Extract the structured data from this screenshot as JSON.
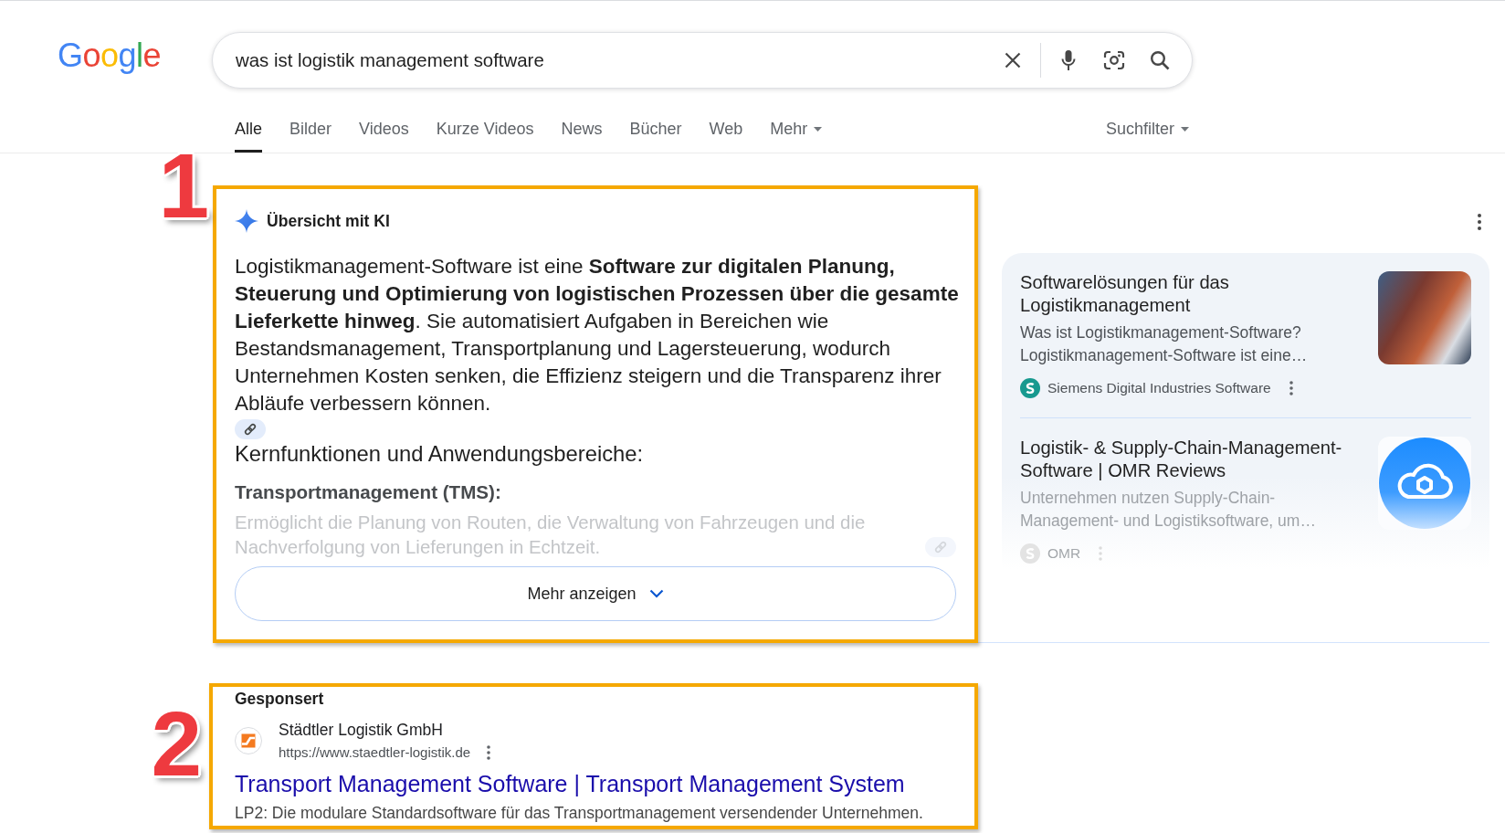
{
  "header": {
    "logo": "Google",
    "search": {
      "value": "was ist logistik management software"
    }
  },
  "tabs": [
    {
      "label": "Alle",
      "selected": true,
      "dropdown": false
    },
    {
      "label": "Bilder",
      "selected": false,
      "dropdown": false
    },
    {
      "label": "Videos",
      "selected": false,
      "dropdown": false
    },
    {
      "label": "Kurze Videos",
      "selected": false,
      "dropdown": false
    },
    {
      "label": "News",
      "selected": false,
      "dropdown": false
    },
    {
      "label": "Bücher",
      "selected": false,
      "dropdown": false
    },
    {
      "label": "Web",
      "selected": false,
      "dropdown": false
    },
    {
      "label": "Mehr",
      "selected": false,
      "dropdown": true
    }
  ],
  "search_filter": {
    "label": "Suchfilter",
    "dropdown": true
  },
  "ai_overview": {
    "annotation": "1",
    "title": "Übersicht mit KI",
    "paragraph": "Logistikmanagement-Software ist eine **Software zur digitalen Planung, Steuerung und Optimierung von logistischen Prozessen über die gesamte Lieferkette hinweg**. Sie automatisiert Aufgaben in Bereichen wie Bestandsmanagement, Transportplanung und Lagersteuerung, wodurch Unternehmen Kosten senken, die Effizienz steigern und die Transparenz ihrer Abläufe verbessern können.",
    "heading": "Kernfunktionen und Anwendungsbereiche:",
    "subheading": "Transportmanagement (TMS):",
    "preview_text": "Ermöglicht die Planung von Routen, die Verwaltung von Fahrzeugen und die Nachverfolgung von Lieferungen in Echtzeit.",
    "more_button": "Mehr anzeigen"
  },
  "sources": [
    {
      "kind": "photo",
      "title": "Softwarelösungen für das Logistikmanagement",
      "snippet": "Was ist Logistikmanagement-Software? Logistikmanagement-Software ist eine…",
      "source": "Siemens Digital Industries Software",
      "color": "#17998f",
      "faded": false
    },
    {
      "kind": "logo",
      "title": "Logistik- & Supply-Chain-Management-Software | OMR Reviews",
      "snippet": "Unternehmen nutzen Supply-Chain-Management- und Logistiksoftware, um…",
      "source": "OMR",
      "color": "#e3e3e3",
      "faded": true
    }
  ],
  "sponsored": {
    "annotation": "2",
    "label": "Gesponsert",
    "advertiser": "Städtler Logistik GmbH",
    "url": "https://www.staedtler-logistik.de",
    "title": "Transport Management Software | Transport Management System",
    "description": "LP2: Die modulare Standardsoftware für das Transportmanagement versendender Unternehmen."
  }
}
